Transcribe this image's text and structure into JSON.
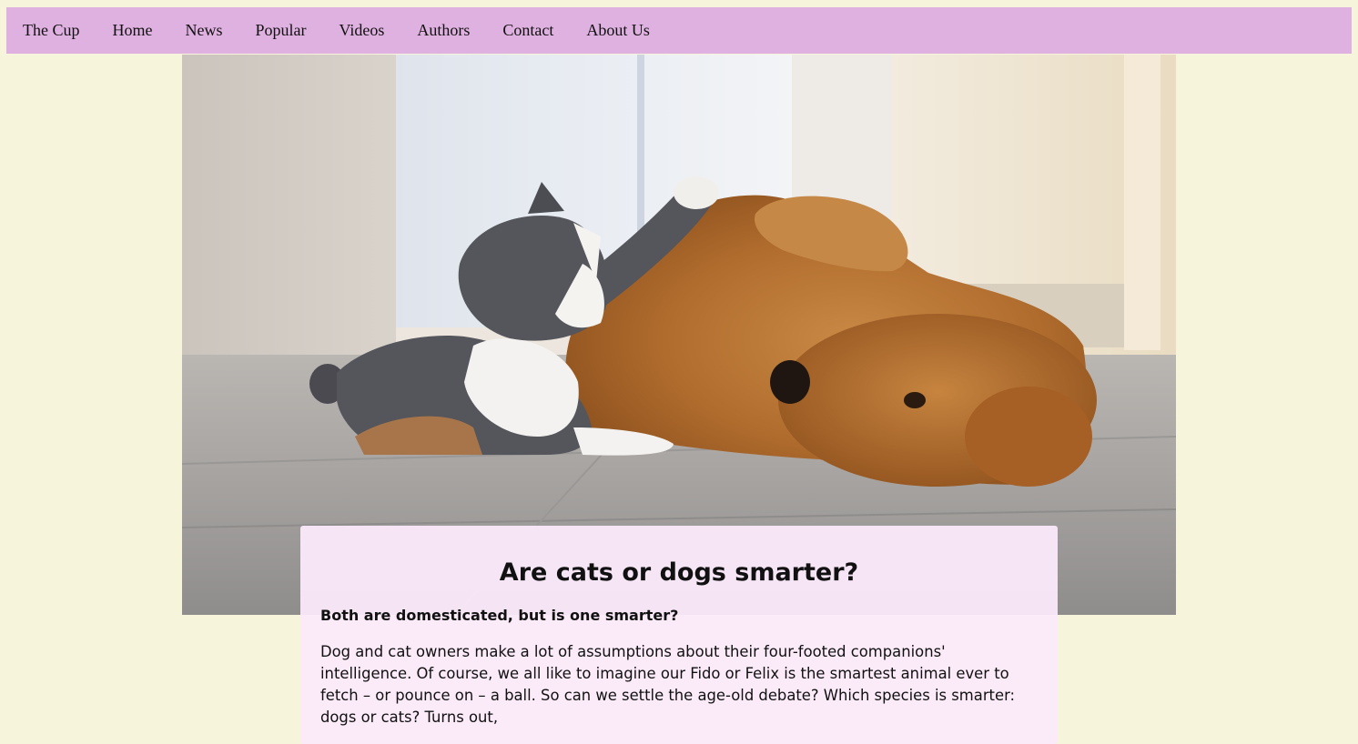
{
  "nav": {
    "items": [
      {
        "label": "The Cup"
      },
      {
        "label": "Home"
      },
      {
        "label": "News"
      },
      {
        "label": "Popular"
      },
      {
        "label": "Videos"
      },
      {
        "label": "Authors"
      },
      {
        "label": "Contact"
      },
      {
        "label": "About Us"
      }
    ]
  },
  "hero": {
    "image": "cat-and-dog-playing-photo"
  },
  "article": {
    "title": "Are cats or dogs smarter?",
    "subtitle": "Both are domesticated, but is one smarter?",
    "body": "Dog and cat owners make a lot of assumptions about their four-footed companions' intelligence. Of course, we all like to imagine our Fido or Felix is the smartest animal ever to fetch – or pounce on – a ball. So can we settle the age-old debate? Which species is smarter: dogs or cats? Turns out,"
  },
  "colors": {
    "page_background": "#f7f4dc",
    "navbar_background": "#dfb1e0",
    "card_background": "#fbeafb"
  }
}
